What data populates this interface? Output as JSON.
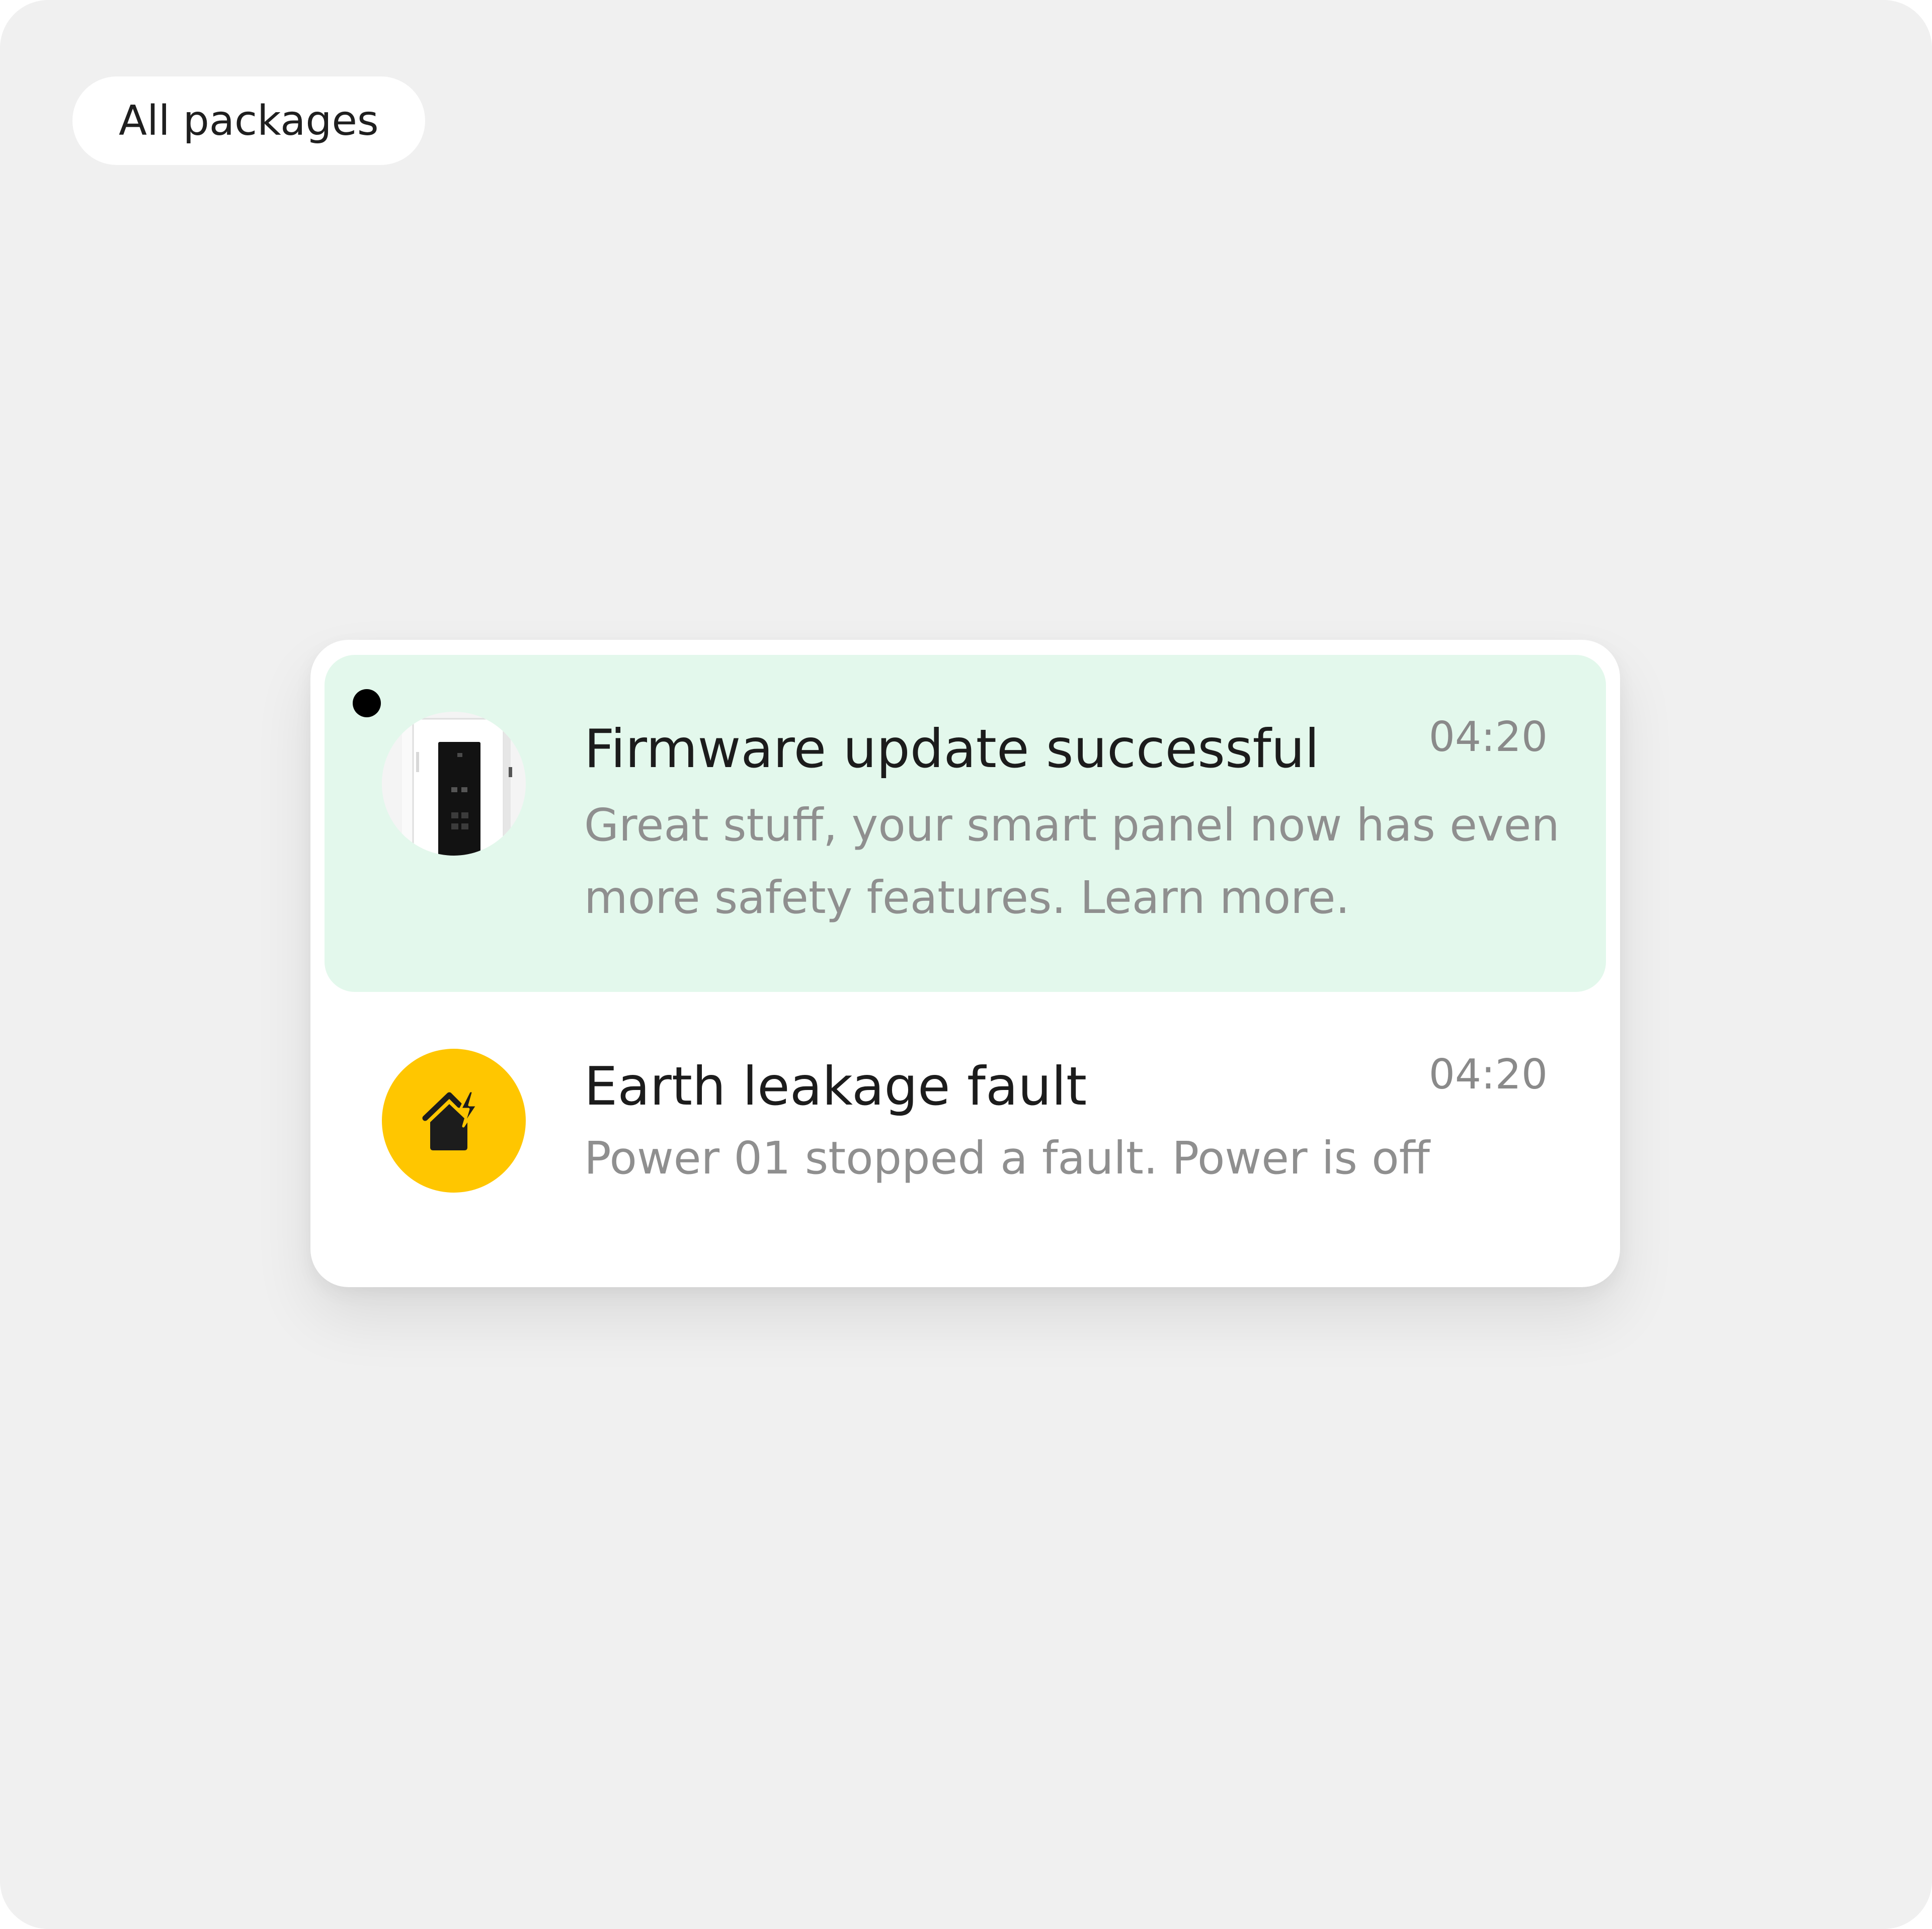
{
  "filter": {
    "label": "All packages"
  },
  "notifications": [
    {
      "title": "Firmware update successful",
      "time": "04:20",
      "body": "Great stuff, your smart panel now has even more safety features. Learn more.",
      "unread": true,
      "icon": "smart-panel-thumbnail"
    },
    {
      "title": "Earth leakage fault",
      "time": "04:20",
      "body": "Power 01 stopped a fault. Power is off",
      "unread": false,
      "icon": "house-lightning-icon"
    }
  ],
  "colors": {
    "background": "#f0f0f0",
    "card": "#ffffff",
    "unread_highlight": "#e3f8ec",
    "warning_badge": "#ffc600",
    "title_text": "#1c1c1c",
    "secondary_text": "#8f8f8f"
  }
}
